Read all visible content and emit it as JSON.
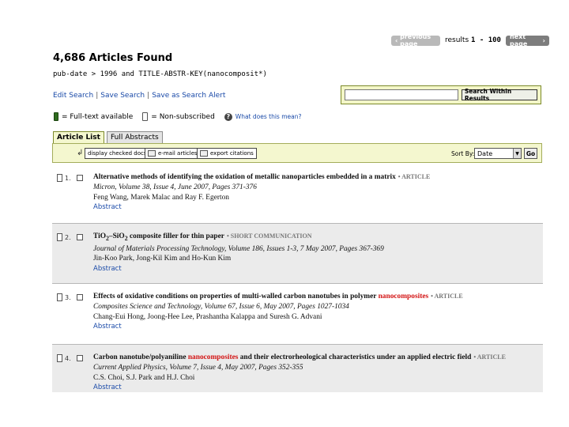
{
  "pager": {
    "previous": "previous page",
    "results_label": "results",
    "results_range": "1 - 100",
    "next": "next page"
  },
  "heading": {
    "count_title": "4,686 Articles Found",
    "query": "pub-date > 1996 and TITLE-ABSTR-KEY(nanocomposit*)"
  },
  "links": {
    "edit": "Edit Search",
    "save": "Save Search",
    "alert": "Save as Search Alert",
    "separator": "|"
  },
  "within": {
    "input_value": "",
    "button": "Search Within Results"
  },
  "legend": {
    "full_text": "= Full-text available",
    "non_sub": "= Non-subscribed",
    "help_icon": "?",
    "help_link": "What does this mean?"
  },
  "tabs": [
    "Article List",
    "Full Abstracts"
  ],
  "toolbar": {
    "display": "display checked docs",
    "email": "e-mail articles",
    "export": "export citations",
    "sort_label": "Sort By:",
    "sort_value": "Date",
    "go": "Go"
  },
  "articles": [
    {
      "num": "1.",
      "title_a": "Alternative methods of identifying the oxidation of metallic nanoparticles embedded in a matrix",
      "highlight": "",
      "title_b": "",
      "type": "• ARTICLE",
      "source": "Micron, Volume 38, Issue 4, June 2007, Pages 371-376",
      "authors": "Feng Wang, Marek Malac and Ray F. Egerton",
      "abstract": "Abstract"
    },
    {
      "num": "2.",
      "title_a": "TiO",
      "sub_a": "2",
      "title_mid": "–SiO",
      "sub_b": "2",
      "title_b": " composite filler for thin paper",
      "type": "• SHORT COMMUNICATION",
      "source": "Journal of Materials Processing Technology, Volume 186, Issues 1-3, 7 May 2007, Pages 367-369",
      "authors": "Jin-Koo Park, Jong-Kil Kim and Ho-Kun Kim",
      "abstract": "Abstract"
    },
    {
      "num": "3.",
      "title_a": "Effects of oxidative conditions on properties of multi-walled carbon nanotubes in polymer ",
      "highlight": "nanocomposites",
      "title_b": "",
      "type": "• ARTICLE",
      "source": "Composites Science and Technology, Volume 67, Issue 6, May 2007, Pages 1027-1034",
      "authors": "Chang-Eui Hong, Joong-Hee Lee, Prashantha Kalappa and Suresh G. Advani",
      "abstract": "Abstract"
    },
    {
      "num": "4.",
      "title_a": "Carbon nanotube/polyaniline ",
      "highlight": "nanocomposites",
      "title_b": " and their electrorheological characteristics under an applied electric field",
      "type": "• ARTICLE",
      "source": "Current Applied Physics, Volume 7, Issue 4, May 2007, Pages 352-355",
      "authors": "C.S. Choi, S.J. Park and H.J. Choi",
      "abstract": "Abstract"
    }
  ],
  "colors": {
    "toolbar_bg": "#f4f7cf",
    "highlight": "#d31414",
    "link": "#1a4aa8",
    "alt_row": "#ebebeb"
  }
}
